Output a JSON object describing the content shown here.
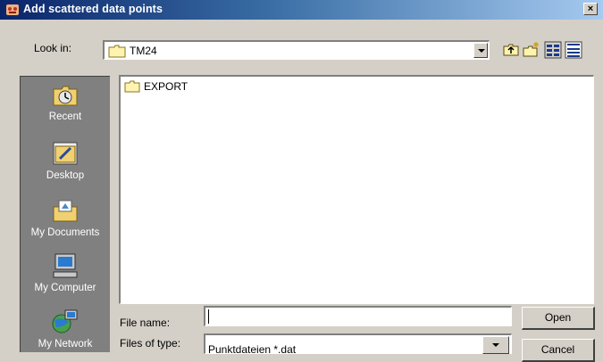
{
  "window": {
    "title": "Add scattered data points",
    "close_glyph": "×"
  },
  "look_in": {
    "label": "Look in:",
    "value": "TM24"
  },
  "toolbar": [
    "up-folder-icon",
    "new-folder-icon",
    "list-view-icon",
    "details-view-icon"
  ],
  "places": [
    {
      "label": "Recent",
      "icon": "recent-icon"
    },
    {
      "label": "Desktop",
      "icon": "desktop-icon"
    },
    {
      "label": "My Documents",
      "icon": "my-documents-icon"
    },
    {
      "label": "My Computer",
      "icon": "my-computer-icon"
    },
    {
      "label": "My Network",
      "icon": "network-icon"
    }
  ],
  "files": [
    {
      "name": "EXPORT",
      "type": "folder"
    }
  ],
  "file_name": {
    "label": "File name:",
    "value": ""
  },
  "file_type": {
    "label": "Files of type:",
    "value": "Punktdateien *.dat"
  },
  "buttons": {
    "open": "Open",
    "cancel": "Cancel"
  },
  "colors": {
    "title_start": "#0a246a",
    "title_end": "#a6caf0",
    "face": "#d4d0c8",
    "places_bg": "#808080"
  }
}
